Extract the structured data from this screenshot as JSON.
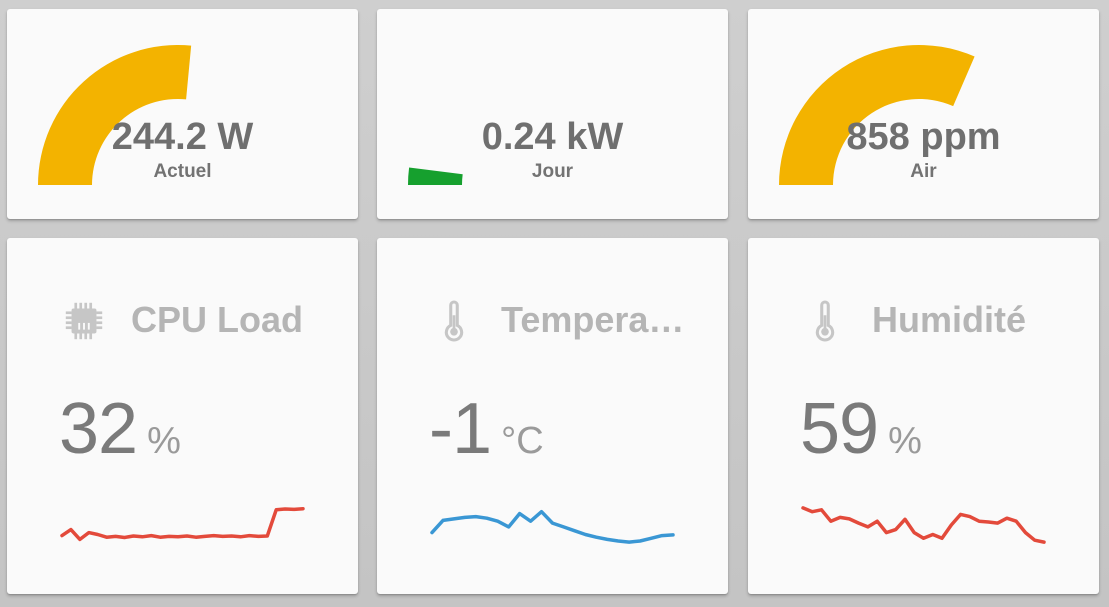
{
  "gauges": [
    {
      "value": "244.2 W",
      "name": "Actuel",
      "fraction": 0.53,
      "color": "#f3b300"
    },
    {
      "value": "0.24 kW",
      "name": "Jour",
      "fraction": 0.04,
      "color": "#16a02e"
    },
    {
      "value": "858 ppm",
      "name": "Air",
      "fraction": 0.63,
      "color": "#f3b300"
    }
  ],
  "sensors": [
    {
      "icon": "cpu-chip-icon",
      "name": "CPU Load",
      "value": "32",
      "unit": "%",
      "line_color": "#e34a3b",
      "history": [
        0.22,
        0.38,
        0.12,
        0.3,
        0.25,
        0.18,
        0.2,
        0.17,
        0.21,
        0.19,
        0.22,
        0.18,
        0.2,
        0.19,
        0.21,
        0.18,
        0.2,
        0.22,
        0.2,
        0.21,
        0.19,
        0.22,
        0.2,
        0.21,
        0.9,
        0.92,
        0.91,
        0.93
      ]
    },
    {
      "icon": "thermometer-icon",
      "name": "Temperature",
      "value": "-1",
      "unit": "°C",
      "line_color": "#3a97d4",
      "history": [
        0.3,
        0.62,
        0.66,
        0.7,
        0.72,
        0.68,
        0.6,
        0.45,
        0.8,
        0.6,
        0.85,
        0.55,
        0.45,
        0.35,
        0.25,
        0.18,
        0.12,
        0.08,
        0.05,
        0.08,
        0.15,
        0.22,
        0.24
      ]
    },
    {
      "icon": "thermometer-icon",
      "name": "Humidité",
      "value": "59",
      "unit": "%",
      "line_color": "#e34a3b",
      "history": [
        0.95,
        0.85,
        0.9,
        0.6,
        0.7,
        0.66,
        0.55,
        0.45,
        0.6,
        0.3,
        0.38,
        0.65,
        0.3,
        0.15,
        0.25,
        0.15,
        0.5,
        0.78,
        0.72,
        0.6,
        0.58,
        0.55,
        0.68,
        0.6,
        0.3,
        0.1,
        0.05
      ]
    }
  ]
}
